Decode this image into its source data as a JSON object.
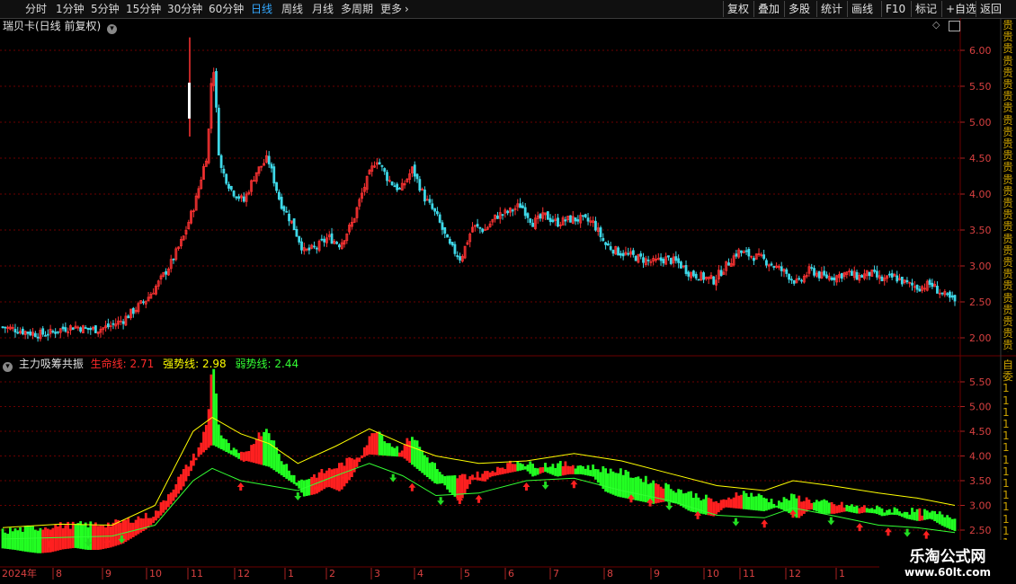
{
  "toolbar": {
    "periods": [
      "分时",
      "1分钟",
      "5分钟",
      "15分钟",
      "30分钟",
      "60分钟",
      "日线",
      "周线",
      "月线",
      "多周期",
      "更多"
    ],
    "active_period": "日线",
    "tools": [
      "复权",
      "叠加",
      "多股",
      "统计",
      "画线",
      "F10",
      "标记",
      "+自选",
      "返回"
    ]
  },
  "main_panel": {
    "title": "瑞贝卡(日线 前复权)",
    "yticks": [
      "6.00",
      "5.50",
      "5.00",
      "4.50",
      "4.00",
      "3.50",
      "3.00",
      "2.50",
      "2.00"
    ]
  },
  "indicator_panel": {
    "name": "主力吸筹共振",
    "lines": [
      {
        "label": "生命线:",
        "value": "2.71",
        "color": "#ff2a2a"
      },
      {
        "label": "强势线:",
        "value": "2.98",
        "color": "#ffff00"
      },
      {
        "label": "弱势线:",
        "value": "2.44",
        "color": "#33ff33"
      }
    ],
    "yticks": [
      "5.50",
      "5.00",
      "4.50",
      "4.00",
      "3.50",
      "3.00",
      "2.50"
    ]
  },
  "x_axis": {
    "labels": [
      "2024年",
      "8",
      "9",
      "10",
      "11",
      "12",
      "1",
      "2",
      "3",
      "4",
      "5",
      "6",
      "7",
      "8",
      "9",
      "10",
      "11",
      "12",
      "1"
    ]
  },
  "right_strip": {
    "top_text": "贵贵贵贵贵贵贵贵贵贵贵贵贵贵贵贵贵贵贵贵贵贵贵贵贵贵贵贵贵",
    "bottom_text": "自委11111111111111"
  },
  "watermark": {
    "line1": "乐淘公式网",
    "line2": "www.60lt.com"
  },
  "colors": {
    "up": "#ff3333",
    "down": "#3ed8e8",
    "grid": "#6b0000",
    "strong_line": "#ffff00",
    "weak_line": "#33ff33",
    "life_red": "#ff2020",
    "life_green": "#22ff22"
  },
  "chart_data": {
    "type": "candlestick",
    "main": {
      "title": "瑞贝卡(日线 前复权)",
      "ylim": [
        1.85,
        6.25
      ],
      "xlim": [
        "2024-07-08",
        "2025-03-06"
      ],
      "close": [
        [
          "2024-07-08",
          2.15
        ],
        [
          "2024-07-15",
          2.12
        ],
        [
          "2024-07-22",
          2.08
        ],
        [
          "2024-07-29",
          2.05
        ],
        [
          "2024-08-05",
          2.07
        ],
        [
          "2024-08-12",
          2.13
        ],
        [
          "2024-08-19",
          2.16
        ],
        [
          "2024-08-26",
          2.12
        ],
        [
          "2024-09-02",
          2.12
        ],
        [
          "2024-09-09",
          2.17
        ],
        [
          "2024-09-16",
          2.25
        ],
        [
          "2024-09-23",
          2.4
        ],
        [
          "2024-09-30",
          2.55
        ],
        [
          "2024-10-07",
          2.78
        ],
        [
          "2024-10-14",
          3.05
        ],
        [
          "2024-10-21",
          3.4
        ],
        [
          "2024-10-28",
          3.9
        ],
        [
          "2024-11-04",
          4.6
        ],
        [
          "2024-11-07",
          5.95
        ],
        [
          "2024-11-11",
          4.4
        ],
        [
          "2024-11-18",
          4.05
        ],
        [
          "2024-11-25",
          3.9
        ],
        [
          "2024-12-02",
          4.3
        ],
        [
          "2024-12-09",
          4.5
        ],
        [
          "2024-12-16",
          3.9
        ],
        [
          "2024-12-23",
          3.6
        ],
        [
          "2024-12-30",
          3.2
        ],
        [
          "2025-01-06",
          3.25
        ],
        [
          "2025-01-13",
          3.4
        ],
        [
          "2025-01-20",
          3.3
        ],
        [
          "2025-01-27",
          3.6
        ],
        [
          "2025-02-03",
          4.1
        ],
        [
          "2025-02-10",
          4.5
        ],
        [
          "2025-02-17",
          4.2
        ],
        [
          "2025-02-24",
          4.05
        ],
        [
          "2025-03-03",
          4.35
        ],
        [
          "2025-03-10",
          3.95
        ],
        [
          "2025-03-17",
          3.7
        ],
        [
          "2025-03-24",
          3.3
        ],
        [
          "2025-03-31",
          3.1
        ],
        [
          "2025-04-07",
          3.55
        ],
        [
          "2025-04-14",
          3.5
        ],
        [
          "2025-04-21",
          3.7
        ],
        [
          "2025-04-28",
          3.75
        ],
        [
          "2025-05-05",
          3.85
        ],
        [
          "2025-05-12",
          3.6
        ],
        [
          "2025-05-19",
          3.7
        ],
        [
          "2025-05-26",
          3.6
        ],
        [
          "2025-06-02",
          3.65
        ],
        [
          "2025-06-09",
          3.65
        ],
        [
          "2025-06-16",
          3.6
        ],
        [
          "2025-06-23",
          3.3
        ],
        [
          "2025-06-30",
          3.2
        ],
        [
          "2025-07-07",
          3.15
        ],
        [
          "2025-07-14",
          3.1
        ],
        [
          "2025-07-21",
          3.05
        ],
        [
          "2025-07-28",
          3.1
        ],
        [
          "2025-08-04",
          3.05
        ],
        [
          "2025-08-11",
          2.9
        ],
        [
          "2025-08-18",
          2.85
        ],
        [
          "2025-08-25",
          2.8
        ],
        [
          "2025-09-01",
          3.0
        ],
        [
          "2025-09-08",
          3.2
        ],
        [
          "2025-09-15",
          3.15
        ],
        [
          "2025-09-22",
          3.1
        ],
        [
          "2025-09-29",
          3.0
        ],
        [
          "2025-10-06",
          2.9
        ],
        [
          "2025-10-13",
          2.75
        ],
        [
          "2025-10-20",
          2.95
        ],
        [
          "2025-10-27",
          2.85
        ],
        [
          "2025-11-03",
          2.85
        ],
        [
          "2025-11-10",
          2.9
        ],
        [
          "2025-11-17",
          2.85
        ],
        [
          "2025-11-24",
          2.9
        ],
        [
          "2025-12-01",
          2.8
        ],
        [
          "2025-12-08",
          2.85
        ],
        [
          "2025-12-15",
          2.75
        ],
        [
          "2025-12-22",
          2.7
        ],
        [
          "2025-12-29",
          2.75
        ],
        [
          "2026-01-05",
          2.6
        ],
        [
          "2026-01-12",
          2.5
        ]
      ]
    },
    "indicator": {
      "name": "主力吸筹共振",
      "ylim": [
        2.3,
        5.85
      ],
      "strong_line": [
        [
          0,
          2.55
        ],
        [
          0.06,
          2.62
        ],
        [
          0.115,
          2.6
        ],
        [
          0.16,
          3.0
        ],
        [
          0.2,
          4.5
        ],
        [
          0.22,
          4.78
        ],
        [
          0.25,
          4.45
        ],
        [
          0.28,
          4.25
        ],
        [
          0.31,
          3.85
        ],
        [
          0.35,
          4.2
        ],
        [
          0.385,
          4.55
        ],
        [
          0.42,
          4.25
        ],
        [
          0.455,
          4.0
        ],
        [
          0.5,
          3.85
        ],
        [
          0.55,
          3.9
        ],
        [
          0.6,
          4.05
        ],
        [
          0.65,
          3.9
        ],
        [
          0.7,
          3.65
        ],
        [
          0.75,
          3.4
        ],
        [
          0.8,
          3.3
        ],
        [
          0.83,
          3.5
        ],
        [
          0.87,
          3.4
        ],
        [
          0.92,
          3.25
        ],
        [
          0.96,
          3.15
        ],
        [
          1,
          3.0
        ]
      ],
      "weak_line": [
        [
          0,
          2.32
        ],
        [
          0.06,
          2.35
        ],
        [
          0.115,
          2.38
        ],
        [
          0.16,
          2.6
        ],
        [
          0.2,
          3.5
        ],
        [
          0.22,
          3.75
        ],
        [
          0.25,
          3.5
        ],
        [
          0.28,
          3.4
        ],
        [
          0.31,
          3.3
        ],
        [
          0.35,
          3.6
        ],
        [
          0.385,
          3.85
        ],
        [
          0.42,
          3.6
        ],
        [
          0.455,
          3.2
        ],
        [
          0.5,
          3.25
        ],
        [
          0.55,
          3.5
        ],
        [
          0.6,
          3.55
        ],
        [
          0.65,
          3.3
        ],
        [
          0.7,
          3.1
        ],
        [
          0.75,
          2.8
        ],
        [
          0.8,
          2.75
        ],
        [
          0.83,
          2.95
        ],
        [
          0.87,
          2.8
        ],
        [
          0.92,
          2.6
        ],
        [
          0.96,
          2.55
        ],
        [
          1,
          2.45
        ]
      ],
      "life_line": [
        [
          0,
          2.4
        ],
        [
          0.06,
          2.52
        ],
        [
          0.115,
          2.55
        ],
        [
          0.16,
          2.75
        ],
        [
          0.2,
          3.9
        ],
        [
          0.22,
          4.25
        ],
        [
          0.25,
          3.95
        ],
        [
          0.28,
          3.8
        ],
        [
          0.31,
          3.4
        ],
        [
          0.35,
          3.7
        ],
        [
          0.385,
          4.05
        ],
        [
          0.42,
          4.0
        ],
        [
          0.455,
          3.45
        ],
        [
          0.5,
          3.55
        ],
        [
          0.55,
          3.75
        ],
        [
          0.6,
          3.75
        ],
        [
          0.65,
          3.6
        ],
        [
          0.7,
          3.3
        ],
        [
          0.75,
          3.0
        ],
        [
          0.8,
          2.9
        ],
        [
          0.83,
          3.1
        ],
        [
          0.87,
          2.95
        ],
        [
          0.92,
          2.85
        ],
        [
          0.96,
          2.8
        ],
        [
          1,
          2.71
        ]
      ]
    }
  }
}
